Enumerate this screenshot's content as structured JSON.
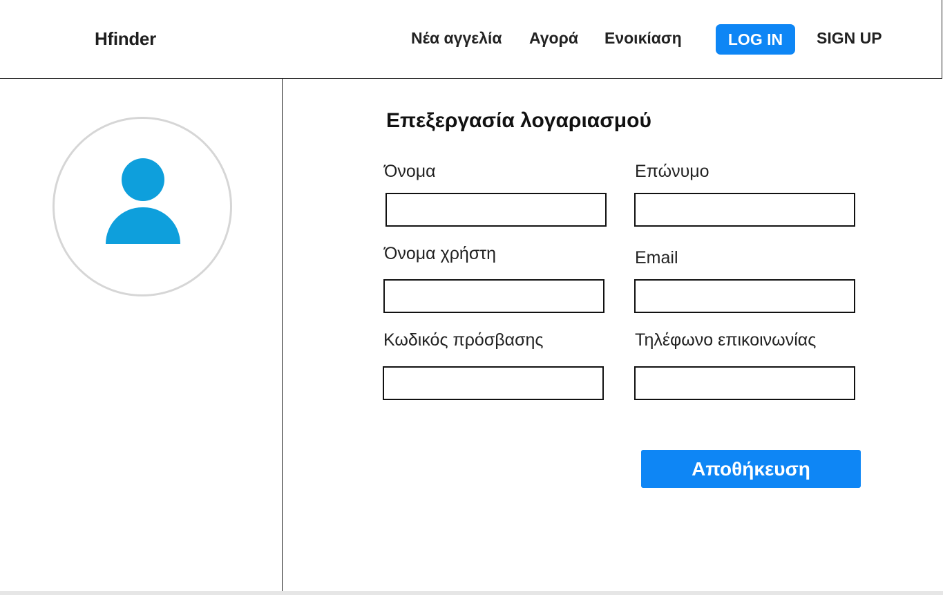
{
  "header": {
    "brand": "Hfinder",
    "nav": {
      "new_listing": "Νέα αγγελία",
      "buy": "Αγορά",
      "rent": "Ενοικίαση"
    },
    "login_label": "LOG IN",
    "signup_label": "SIGN UP"
  },
  "profile": {
    "avatar_icon": "user-avatar-icon"
  },
  "form": {
    "title": "Επεξεργασία λογαριασμού",
    "first_name": {
      "label": "Όνομα",
      "value": ""
    },
    "last_name": {
      "label": "Επώνυμο",
      "value": ""
    },
    "username": {
      "label": "Όνομα χρήστη",
      "value": ""
    },
    "email": {
      "label": "Email",
      "value": ""
    },
    "password": {
      "label": "Κωδικός πρόσβασης",
      "value": ""
    },
    "phone": {
      "label": "Τηλέφωνο επικοινωνίας",
      "value": ""
    },
    "save_label": "Αποθήκευση"
  },
  "colors": {
    "accent": "#0e86f5",
    "avatar": "#0e9fdc",
    "avatar_ring": "#d6d6d6"
  }
}
